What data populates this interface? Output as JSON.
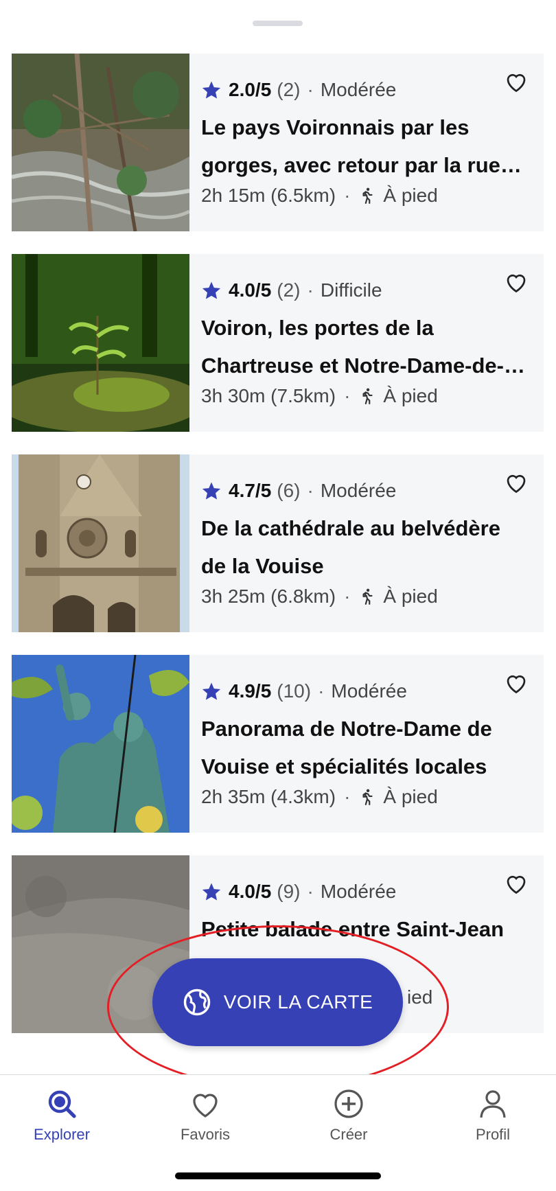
{
  "list": {
    "items": [
      {
        "rating": "2.0/5",
        "count": "(2)",
        "difficulty": "Modérée",
        "title": "Le pays Voironnais par les gorges, avec retour par la rue p…",
        "duration": "2h 15m (6.5km)",
        "mode": "À pied",
        "image": "forest-stream-photo"
      },
      {
        "rating": "4.0/5",
        "count": "(2)",
        "difficulty": "Difficile",
        "title": "Voiron, les portes de la Chartreuse et Notre-Dame-de-…",
        "duration": "3h 30m (7.5km)",
        "mode": "À pied",
        "image": "sapling-photo"
      },
      {
        "rating": "4.7/5",
        "count": "(6)",
        "difficulty": "Modérée",
        "title": "De la cathédrale au belvédère de la Vouise",
        "duration": "3h 25m (6.8km)",
        "mode": "À pied",
        "image": "cathedral-photo"
      },
      {
        "rating": "4.9/5",
        "count": "(10)",
        "difficulty": "Modérée",
        "title": "Panorama de Notre-Dame de Vouise et spécialités locales",
        "duration": "2h 35m (4.3km)",
        "mode": "À pied",
        "image": "statue-photo"
      },
      {
        "rating": "4.0/5",
        "count": "(9)",
        "difficulty": "Modérée",
        "title": "Petite balade entre Saint-Jean … isse et Coubl…",
        "duration": "",
        "mode": "ied",
        "image": "gravel-path-photo"
      }
    ]
  },
  "fab": {
    "label": "VOIR LA CARTE",
    "icon": "globe-icon"
  },
  "nav": {
    "explorer": "Explorer",
    "favoris": "Favoris",
    "creer": "Créer",
    "profil": "Profil"
  },
  "colors": {
    "accent": "#3641b6",
    "card_bg": "#f5f6f8",
    "annotation": "#e31e24"
  }
}
